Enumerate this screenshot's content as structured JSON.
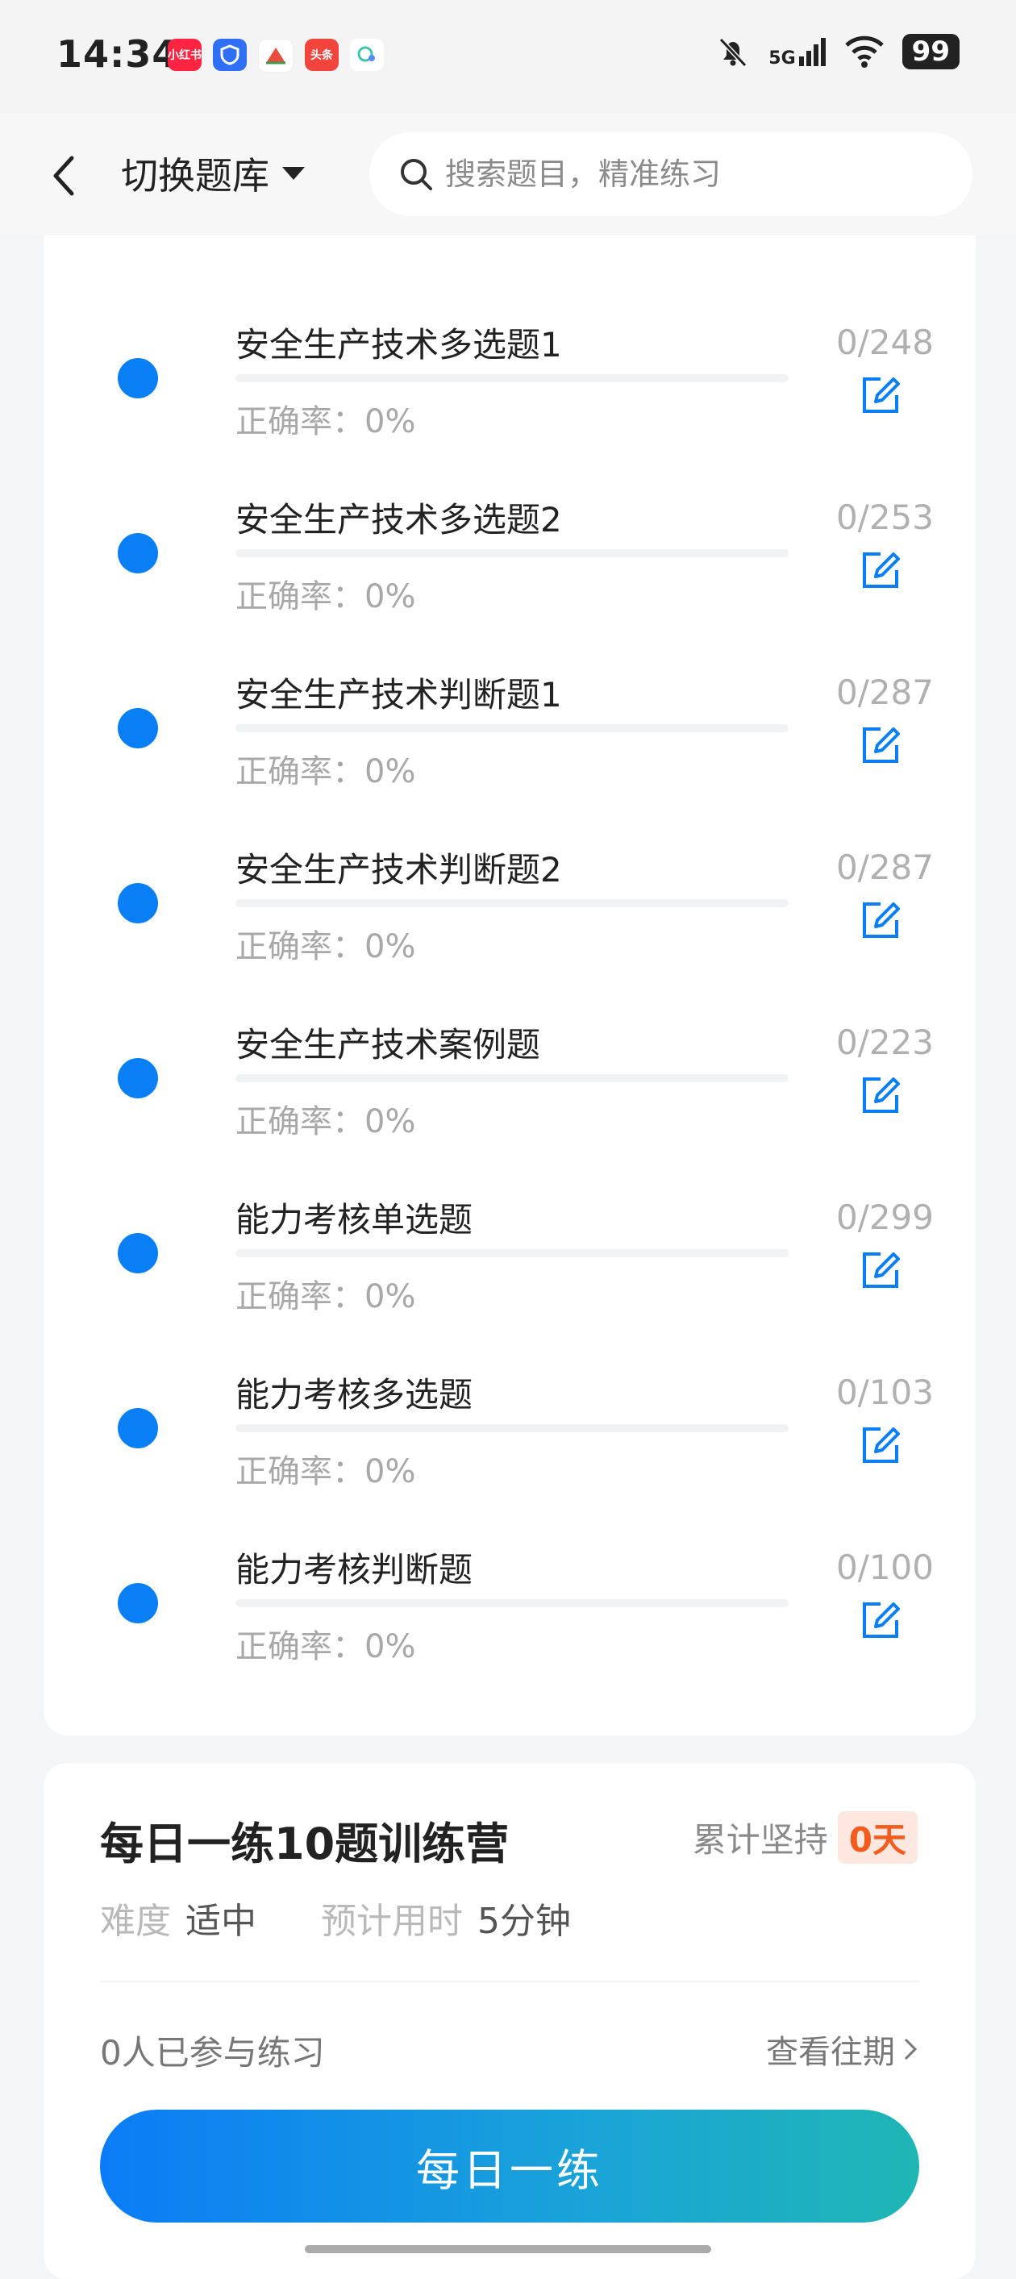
{
  "status_bar": {
    "time": "14:34",
    "signal": "5G",
    "battery": "99",
    "app_icons": [
      {
        "label": "小红书",
        "color": "#ff2442"
      },
      {
        "label": "",
        "color": "#2f6ff5"
      },
      {
        "label": "",
        "color": "#e94b3c"
      },
      {
        "label": "头条",
        "color": "#f0443c"
      },
      {
        "label": "",
        "color": "#3ec6a6"
      }
    ]
  },
  "header": {
    "switch_label": "切换题库",
    "search_placeholder": "搜索题目，精准练习"
  },
  "accuracy_prefix": "正确率：",
  "partial_row": {
    "accuracy": "0%"
  },
  "rows": [
    {
      "title": "安全生产技术多选题1",
      "count": "0/248",
      "accuracy": "0%",
      "progress": 0
    },
    {
      "title": "安全生产技术多选题2",
      "count": "0/253",
      "accuracy": "0%",
      "progress": 0
    },
    {
      "title": "安全生产技术判断题1",
      "count": "0/287",
      "accuracy": "0%",
      "progress": 0
    },
    {
      "title": "安全生产技术判断题2",
      "count": "0/287",
      "accuracy": "0%",
      "progress": 0
    },
    {
      "title": "安全生产技术案例题",
      "count": "0/223",
      "accuracy": "0%",
      "progress": 0
    },
    {
      "title": "能力考核单选题",
      "count": "0/299",
      "accuracy": "0%",
      "progress": 0
    },
    {
      "title": "能力考核多选题",
      "count": "0/103",
      "accuracy": "0%",
      "progress": 0
    },
    {
      "title": "能力考核判断题",
      "count": "0/100",
      "accuracy": "0%",
      "progress": 0
    }
  ],
  "camp": {
    "title": "每日一练10题训练营",
    "streak_label": "累计坚持",
    "streak_value": "0天",
    "difficulty_label": "难度",
    "difficulty_value": "适中",
    "time_label": "预计用时",
    "time_value": "5分钟",
    "joined_text": "0人已参与练习",
    "history_label": "查看往期",
    "button_label": "每日一练"
  },
  "colors": {
    "accent": "#0a7ff5",
    "streak": "#f25c1e"
  }
}
